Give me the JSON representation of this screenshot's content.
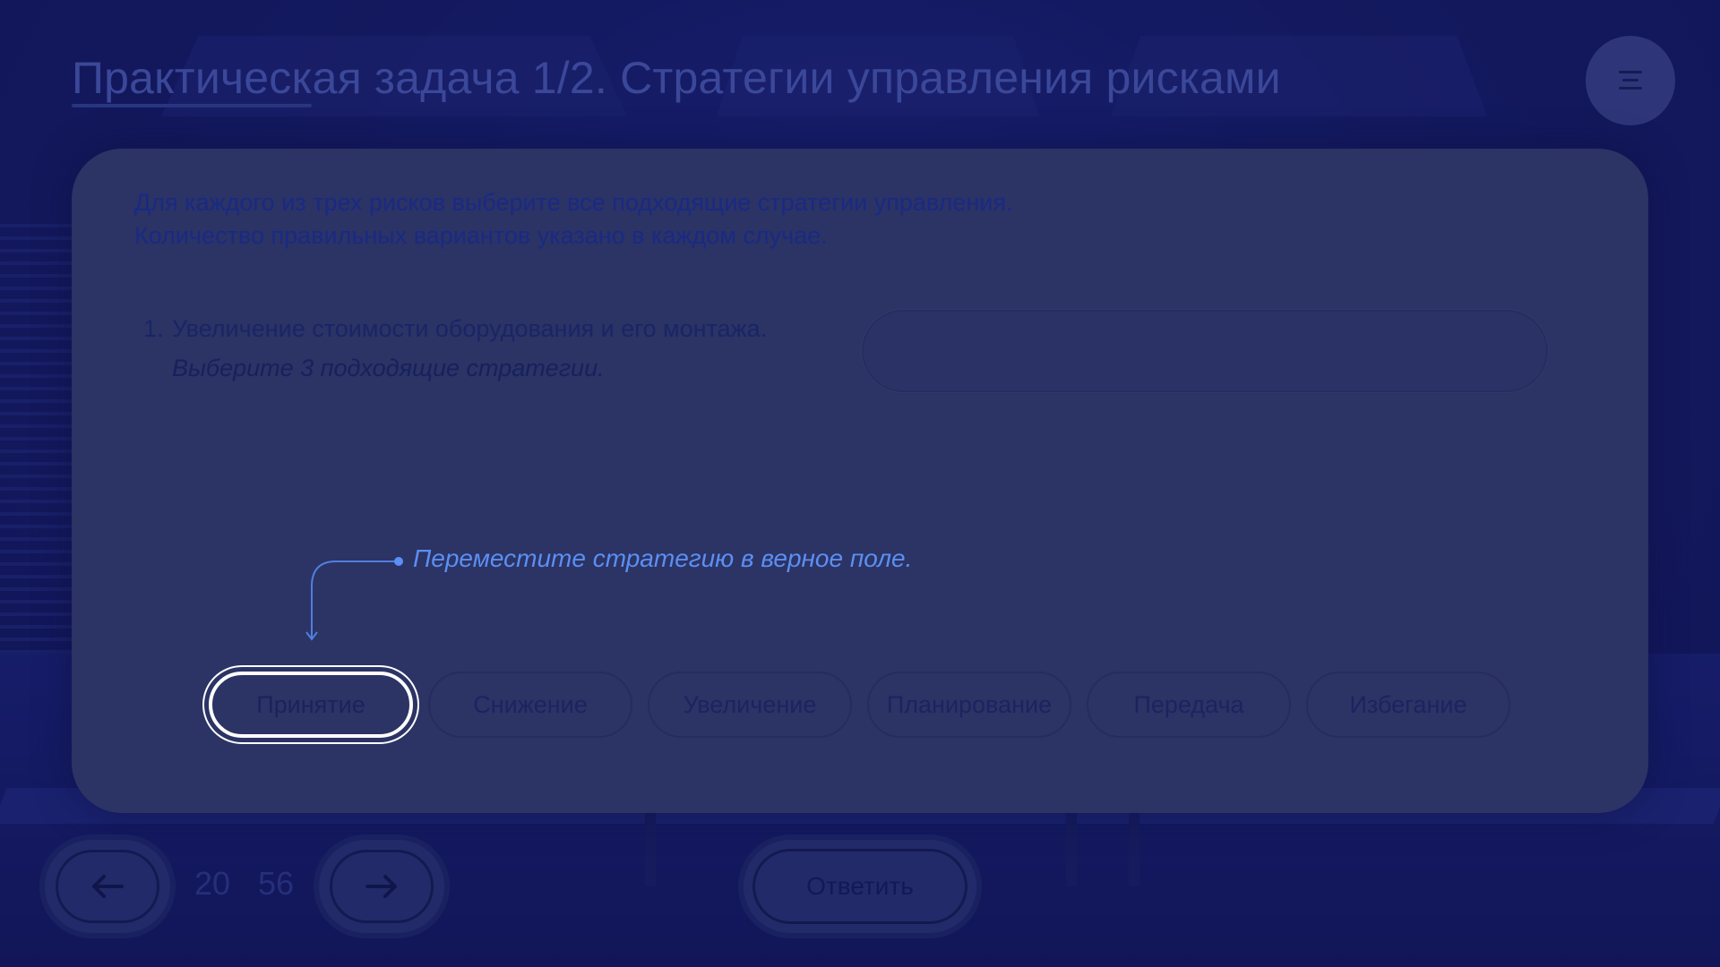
{
  "header": {
    "title": "Практическая задача 1/2. Стратегии управления рисками"
  },
  "task": {
    "instruction_line1": "Для каждого из трех рисков выберите все подходящие стратегии управления.",
    "instruction_line2": "Количество правильных вариантов указано в каждом случае.",
    "question": {
      "number": "1.",
      "text": "Увеличение стоимости оборудования и его монтажа.",
      "hint": "Выберите 3 подходящие стратегии."
    },
    "drag_hint": "Переместите стратегию в верное поле."
  },
  "options": [
    {
      "label": "Принятие",
      "selected": true
    },
    {
      "label": "Снижение",
      "selected": false
    },
    {
      "label": "Увеличение",
      "selected": false
    },
    {
      "label": "Планирование",
      "selected": false
    },
    {
      "label": "Передача",
      "selected": false
    },
    {
      "label": "Избегание",
      "selected": false
    }
  ],
  "footer": {
    "current_page": "20",
    "total_pages": "56",
    "answer_label": "Ответить"
  },
  "icons": {
    "menu": "menu-icon",
    "prev": "arrow-left-icon",
    "next": "arrow-right-icon"
  },
  "colors": {
    "accent_hint": "#5b8ff2",
    "card_bg": "#2c3365",
    "page_bg": "#12195e",
    "selected_border": "#ffffff"
  }
}
